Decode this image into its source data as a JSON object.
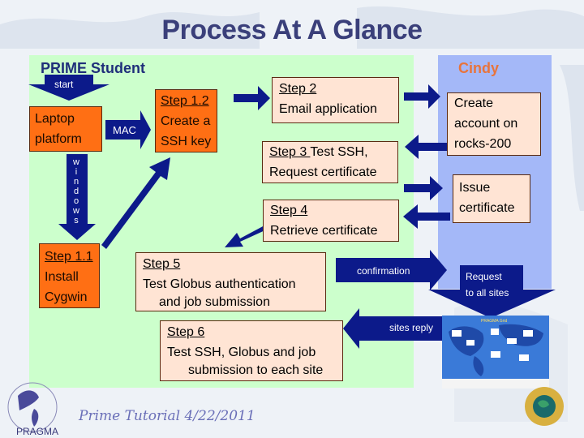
{
  "title": "Process At A Glance",
  "lanes": {
    "student": "PRIME Student",
    "cindy": "Cindy"
  },
  "arrows": {
    "start": "start",
    "mac": "MAC",
    "windows": [
      "w",
      "i",
      "n",
      "d",
      "o",
      "w",
      "s"
    ],
    "confirmation": "confirmation",
    "request_line1": "Request",
    "request_line2": "to all sites",
    "sites_reply": "sites reply"
  },
  "boxes": {
    "laptop": {
      "line1": "Laptop",
      "line2": "platform"
    },
    "step11": {
      "step": "Step 1.1",
      "line1": "Install",
      "line2": "Cygwin"
    },
    "step12": {
      "step": "Step 1.2",
      "line1": "Create a",
      "line2": "SSH key"
    },
    "step2": {
      "step": "Step 2",
      "line1": "Email application"
    },
    "step3": {
      "step": "Step 3 ",
      "line1": "Test SSH,",
      "line2": "Request certificate"
    },
    "step4": {
      "step": "Step 4",
      "line1": "Retrieve certificate"
    },
    "step5": {
      "step": "Step 5",
      "line1": "Test Globus authentication",
      "line2": "and job submission"
    },
    "step6": {
      "step": "Step 6",
      "line1": "Test SSH, Globus and job",
      "line2": "submission to each site"
    },
    "create_account": {
      "line1": "Create",
      "line2": "account on",
      "line3": "rocks-200"
    },
    "issue_cert": {
      "line1": "Issue",
      "line2": "certificate"
    }
  },
  "map_title": "PRAGMA Grid",
  "footer": "Prime Tutorial 4/22/2011",
  "logo_text": "PRAGMA",
  "colors": {
    "title": "#3a3f7a",
    "student_lane": "#ccffcc",
    "cindy_lane": "#a4b8f8",
    "arrow": "#0c1a8a",
    "orange_box": "#ff6f14",
    "peach_box": "#ffe4d4",
    "cindy_label": "#e8743c"
  }
}
